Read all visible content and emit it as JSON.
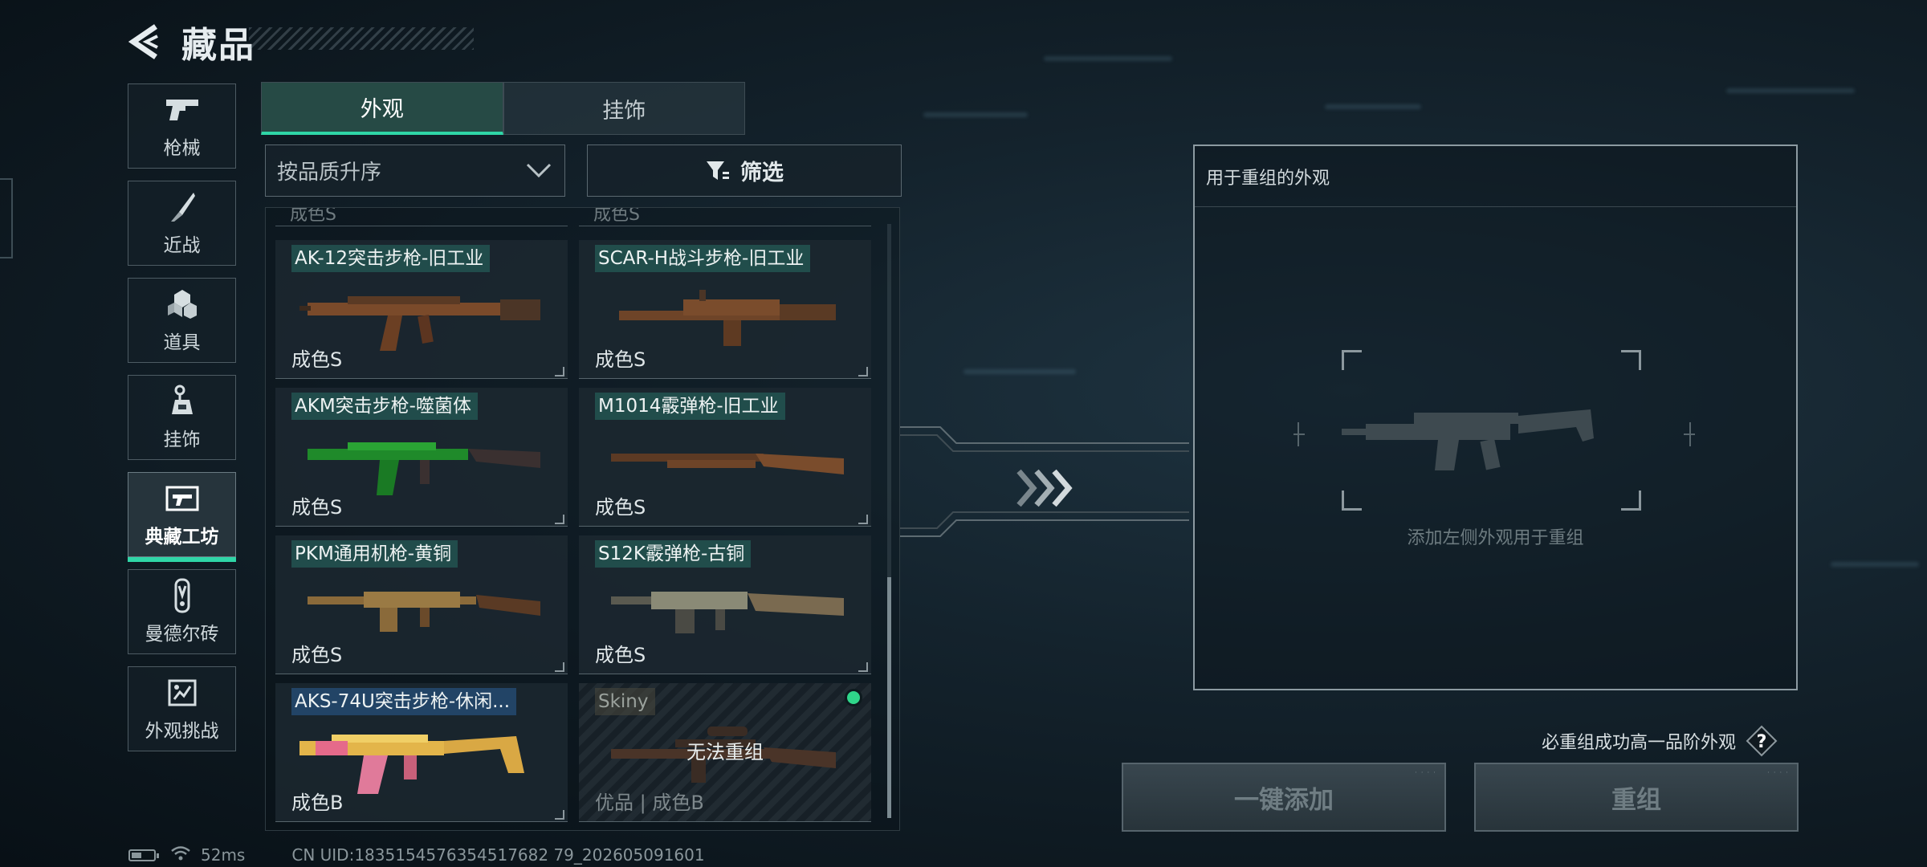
{
  "header": {
    "title": "藏品"
  },
  "nav": {
    "items": [
      {
        "label": "枪械",
        "icon": "pistol-icon"
      },
      {
        "label": "近战",
        "icon": "knife-icon"
      },
      {
        "label": "道具",
        "icon": "grenades-icon"
      },
      {
        "label": "挂饰",
        "icon": "charm-icon"
      },
      {
        "label": "典藏工坊",
        "icon": "workshop-icon",
        "active": true
      },
      {
        "label": "曼德尔砖",
        "icon": "brick-icon"
      },
      {
        "label": "外观挑战",
        "icon": "challenge-icon"
      }
    ]
  },
  "tabs": [
    {
      "label": "外观",
      "active": true
    },
    {
      "label": "挂饰",
      "active": false
    }
  ],
  "sort": {
    "label": "按品质升序"
  },
  "filter": {
    "label": "筛选"
  },
  "list": {
    "cut_top": [
      "成色S",
      "成色S"
    ],
    "items": [
      {
        "name": "AK-12突击步枪-旧工业",
        "grade": "成色S",
        "tone": "rust"
      },
      {
        "name": "SCAR-H战斗步枪-旧工业",
        "grade": "成色S",
        "tone": "rust"
      },
      {
        "name": "AKM突击步枪-噬菌体",
        "grade": "成色S",
        "tone": "green"
      },
      {
        "name": "M1014霰弹枪-旧工业",
        "grade": "成色S",
        "tone": "rust"
      },
      {
        "name": "PKM通用机枪-黄铜",
        "grade": "成色S",
        "tone": "brass"
      },
      {
        "name": "S12K霰弹枪-古铜",
        "grade": "成色S",
        "tone": "bronze"
      },
      {
        "name": "AKS-74U突击步枪-休闲...",
        "grade": "成色B",
        "tone": "pink"
      },
      {
        "name": "Skiny",
        "grade": "优品 | 成色B",
        "overlay": "无法重组",
        "disabled": true
      }
    ]
  },
  "panel": {
    "title": "用于重组的外观",
    "placeholder": "添加左侧外观用于重组"
  },
  "note": "必重组成功高一品阶外观",
  "buttons": {
    "add_all": "一键添加",
    "remix": "重组"
  },
  "status": {
    "ping": "52ms",
    "uid": "CN UID:1835154576354517682 79_202605091601"
  },
  "colors": {
    "accent": "#2fd6a7",
    "background": "#14232d",
    "active_tab": "#264a45"
  }
}
